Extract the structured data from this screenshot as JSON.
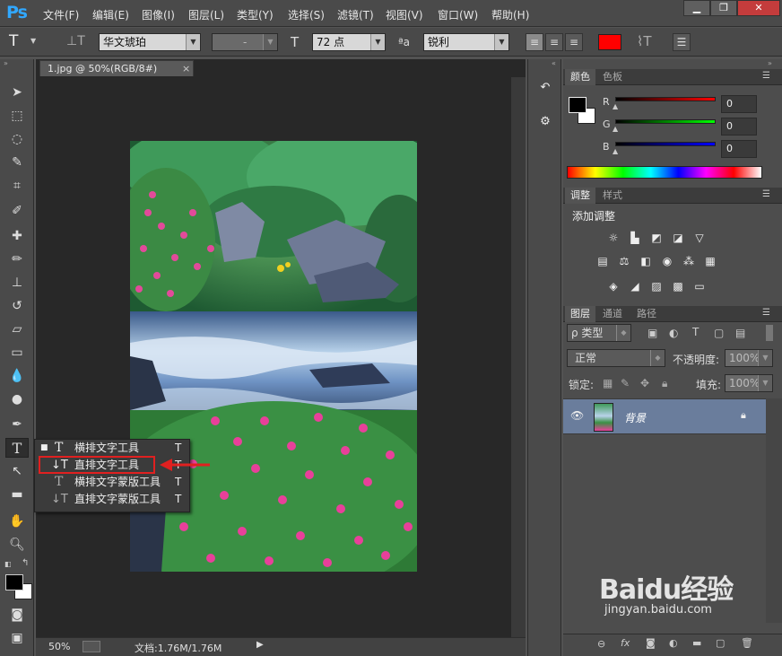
{
  "app": {
    "logo": "Ps"
  },
  "menu": [
    "文件(F)",
    "编辑(E)",
    "图像(I)",
    "图层(L)",
    "类型(Y)",
    "选择(S)",
    "滤镜(T)",
    "视图(V)",
    "窗口(W)",
    "帮助(H)"
  ],
  "window_controls": {
    "minimize": "▁",
    "restore": "❐",
    "close": "✕"
  },
  "options": {
    "tool_glyph": "T",
    "font_family": "华文琥珀",
    "font_style": "-",
    "font_size": "72 点",
    "aa_label": "ªa",
    "anti_alias": "锐利",
    "text_color": "#ff0000"
  },
  "document": {
    "tab_title": "1.jpg @ 50%(RGB/8#)",
    "tab_close": "×"
  },
  "status": {
    "zoom": "50%",
    "doc_info": "文档:1.76M/1.76M"
  },
  "type_tool_menu": {
    "items": [
      {
        "icon": "T",
        "label": "横排文字工具",
        "shortcut": "T",
        "current": true
      },
      {
        "icon": "↓T",
        "label": "直排文字工具",
        "shortcut": "T",
        "highlighted": true
      },
      {
        "icon": "T",
        "label": "横排文字蒙版工具",
        "shortcut": "T"
      },
      {
        "icon": "↓T",
        "label": "直排文字蒙版工具",
        "shortcut": "T"
      }
    ],
    "highlight_color": "#e02020"
  },
  "color_panel": {
    "tabs": [
      "颜色",
      "色板"
    ],
    "channels": [
      {
        "label": "R",
        "value": "0"
      },
      {
        "label": "G",
        "value": "0"
      },
      {
        "label": "B",
        "value": "0"
      }
    ]
  },
  "adjust_panel": {
    "tabs": [
      "调整",
      "样式"
    ],
    "title": "添加调整"
  },
  "layers_panel": {
    "tabs": [
      "图层",
      "通道",
      "路径"
    ],
    "filter": "ρ 类型",
    "blend_mode": "正常",
    "opacity_label": "不透明度:",
    "opacity": "100%",
    "lock_label": "锁定:",
    "fill_label": "填充:",
    "fill": "100%",
    "layer_name": "背景"
  },
  "watermark": {
    "brand": "Baidu经验",
    "url": "jingyan.baidu.com"
  }
}
